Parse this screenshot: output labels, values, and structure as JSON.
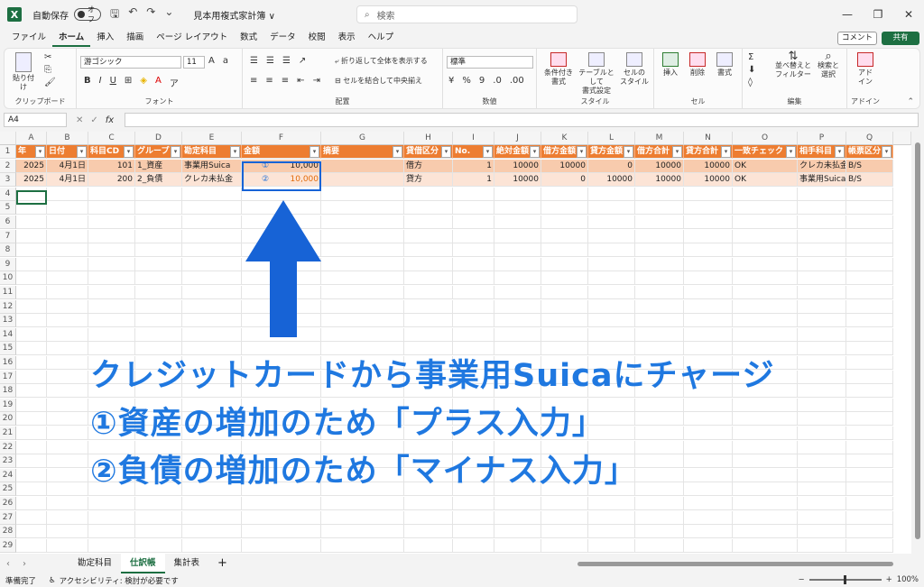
{
  "titlebar": {
    "app_icon": "X",
    "autosave_label": "自動保存",
    "autosave_state": "オフ",
    "document_title": "見本用複式家計簿 ∨",
    "search_placeholder": "検索"
  },
  "menu": {
    "tabs": [
      "ファイル",
      "ホーム",
      "挿入",
      "描画",
      "ページ レイアウト",
      "数式",
      "データ",
      "校閲",
      "表示",
      "ヘルプ"
    ],
    "active": "ホーム",
    "comment_label": "コメント",
    "share_label": "共有"
  },
  "ribbon": {
    "paste": "貼り付け",
    "clipboard": "クリップボード",
    "font_name": "游ゴシック",
    "font_size": "11",
    "font_group": "フォント",
    "wrap_text": "折り返して全体を表示する",
    "merge_center": "セルを結合して中央揃え",
    "alignment_group": "配置",
    "number_format": "標準",
    "number_group": "数値",
    "cond_format": [
      "条件付き",
      "書式"
    ],
    "table_format": [
      "テーブルとして",
      "書式設定"
    ],
    "cell_style": [
      "セルの",
      "スタイル"
    ],
    "style_group": "スタイル",
    "insert": "挿入",
    "delete": "削除",
    "format": "書式",
    "cells_group": "セル",
    "sort_filter": [
      "並べ替えと",
      "フィルター"
    ],
    "find_select": [
      "検索と",
      "選択"
    ],
    "edit_group": "編集",
    "addin": [
      "アド",
      "イン"
    ],
    "addin_group": "アドイン"
  },
  "formula_bar": {
    "name_box": "A4",
    "fx": "fx",
    "content": ""
  },
  "sheet": {
    "columns": [
      "A",
      "B",
      "C",
      "D",
      "E",
      "F",
      "G",
      "H",
      "I",
      "J",
      "K",
      "L",
      "M",
      "N",
      "O",
      "P",
      "Q"
    ],
    "row_numbers": [
      "1",
      "2",
      "3",
      "4",
      "5",
      "6",
      "7",
      "8",
      "9",
      "10",
      "11",
      "12",
      "13",
      "14",
      "15",
      "16",
      "17",
      "18",
      "19",
      "20",
      "21",
      "22",
      "23",
      "24",
      "25",
      "26",
      "27",
      "28",
      "29"
    ],
    "headers": [
      "年",
      "日付",
      "科目CD",
      "グループ",
      "勘定科目",
      "金額",
      "摘要",
      "貸借区分",
      "No.",
      "絶対金額",
      "借方金額",
      "貸方金額",
      "借方合計",
      "貸方合計",
      "一致チェック",
      "相手科目",
      "帳票区分"
    ],
    "rows": [
      [
        "2025",
        "4月1日",
        "101",
        "1_資産",
        "事業用Suica",
        "10,000",
        "",
        "借方",
        "1",
        "10000",
        "10000",
        "0",
        "10000",
        "10000",
        "OK",
        "クレカ未払金",
        "B/S"
      ],
      [
        "2025",
        "4月1日",
        "200",
        "2_負債",
        "クレカ未払金",
        "10,000",
        "",
        "貸方",
        "1",
        "10000",
        "0",
        "10000",
        "10000",
        "10000",
        "OK",
        "事業用Suica",
        "B/S"
      ]
    ],
    "circle_marks": [
      "①",
      "②"
    ]
  },
  "annotation": {
    "line1": "クレジットカードから事業用Suicaにチャージ",
    "line2": "①資産の増加のため「プラス入力」",
    "line3": "②負債の増加のため「マイナス入力」",
    "color": "#1f78e0"
  },
  "sheet_tabs": {
    "tabs": [
      "勘定科目",
      "仕訳帳",
      "集計表"
    ],
    "active": "仕訳帳",
    "add": "+"
  },
  "status": {
    "ready": "準備完了",
    "accessibility": "アクセシビリティ: 検討が必要です",
    "zoom": "100%"
  },
  "colors": {
    "header_fill": "#ed7d31",
    "row_fill_1": "#f8cbad",
    "row_fill_2": "#fce4d6",
    "excel_green": "#1d6f42",
    "highlight_blue": "#1763d6"
  }
}
